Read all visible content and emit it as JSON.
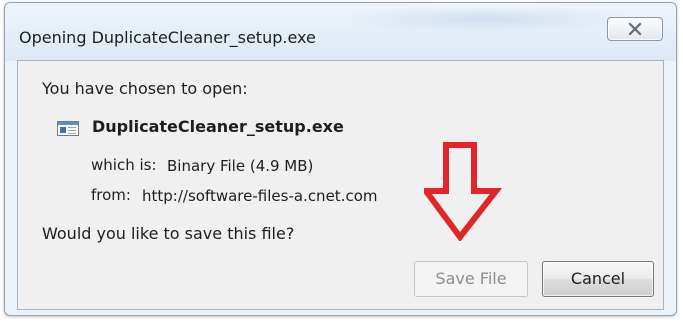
{
  "dialog": {
    "title": "Opening DuplicateCleaner_setup.exe",
    "close_icon": "close-icon"
  },
  "content": {
    "intro": "You have chosen to open:",
    "file_icon": "exe-file-icon",
    "file_name": "DuplicateCleaner_setup.exe",
    "which_is_label": "which is:",
    "which_is_value": "Binary File (4.9 MB)",
    "from_label": "from:",
    "from_value": "http://software-files-a.cnet.com",
    "question": "Would you like to save this file?"
  },
  "buttons": {
    "save_label": "Save File",
    "cancel_label": "Cancel"
  },
  "annotation": {
    "icon": "down-arrow-icon",
    "color": "#e0252b"
  }
}
